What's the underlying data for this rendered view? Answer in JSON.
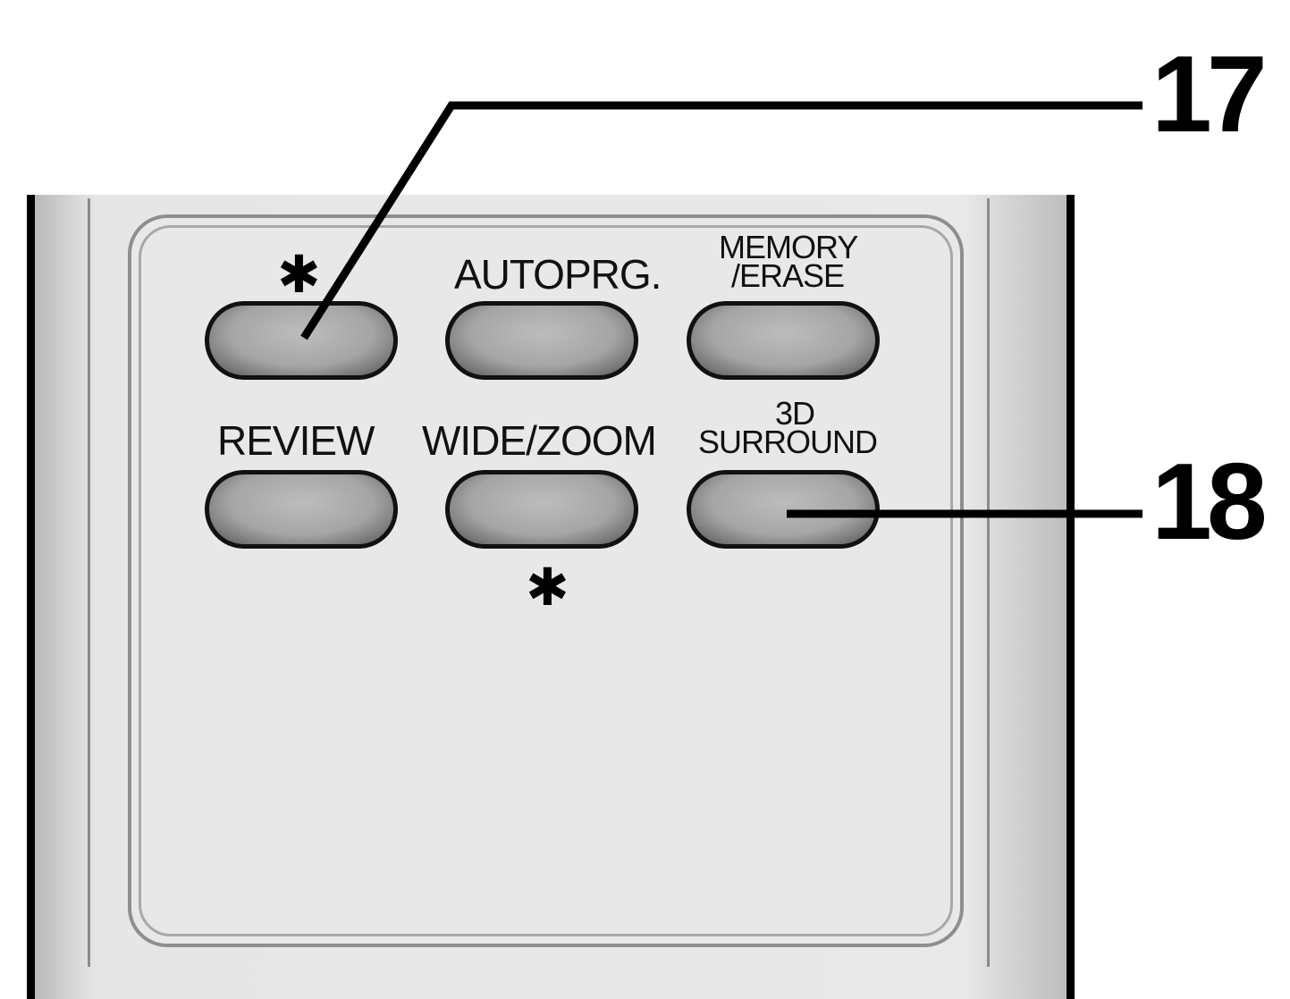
{
  "buttons": [
    {
      "id": "star-1",
      "label": ""
    },
    {
      "id": "autoprg",
      "label": "AUTOPRG."
    },
    {
      "id": "memory-erase",
      "label_line1": "MEMORY",
      "label_line2": "/ERASE"
    },
    {
      "id": "review",
      "label": "REVIEW"
    },
    {
      "id": "wide-zoom",
      "label": "WIDE/ZOOM"
    },
    {
      "id": "3d-surround",
      "label_line1": "3D",
      "label_line2": "SURROUND"
    }
  ],
  "markers": {
    "star_top": "✱",
    "star_bottom": "✱"
  },
  "callouts": {
    "top": "17",
    "bottom": "18"
  },
  "colors": {
    "button_fill": "#a5a5a5",
    "panel": "#e8e8e8",
    "outline": "#111111"
  }
}
